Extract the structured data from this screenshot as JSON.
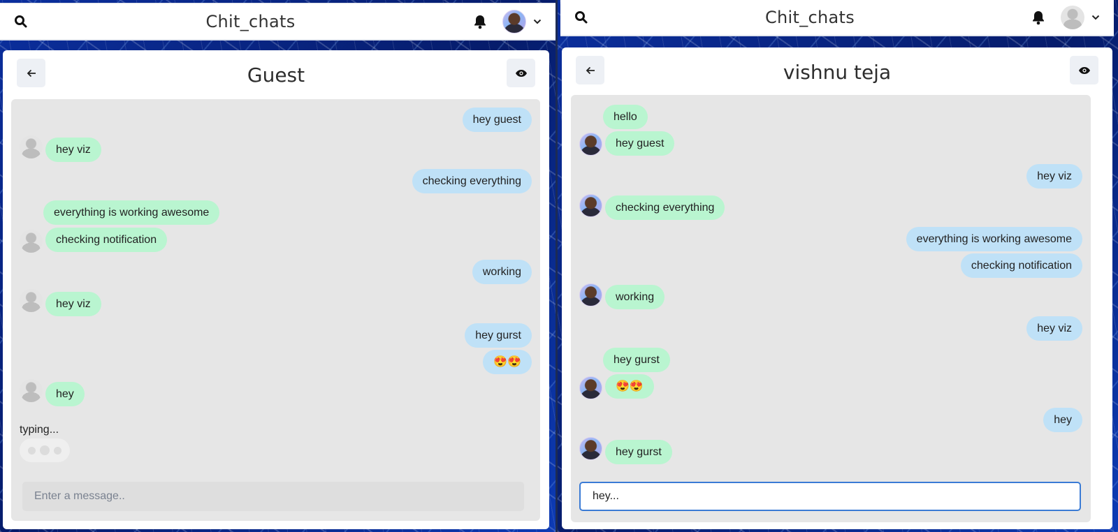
{
  "app": {
    "brand": "Chit_chats"
  },
  "left": {
    "chat_title": "Guest",
    "messages": [
      {
        "text": "hey guest",
        "side": "mine"
      },
      {
        "text": "hey viz",
        "side": "theirs"
      },
      {
        "text": "checking everything",
        "side": "mine"
      },
      {
        "text": "everything is working awesome",
        "side": "theirs"
      },
      {
        "text": "checking notification",
        "side": "theirs"
      },
      {
        "text": "working",
        "side": "mine"
      },
      {
        "text": "hey viz",
        "side": "theirs"
      },
      {
        "text": "hey gurst",
        "side": "mine"
      },
      {
        "text": "😍😍",
        "side": "mine"
      },
      {
        "text": "hey",
        "side": "theirs"
      }
    ],
    "typing_label": "typing...",
    "input": {
      "placeholder": "Enter a message..",
      "value": ""
    }
  },
  "right": {
    "chat_title": "vishnu teja",
    "messages": [
      {
        "text": "hello",
        "side": "theirs"
      },
      {
        "text": "hey guest",
        "side": "theirs"
      },
      {
        "text": "hey viz",
        "side": "mine"
      },
      {
        "text": "checking everything",
        "side": "theirs"
      },
      {
        "text": "everything is working awesome",
        "side": "mine"
      },
      {
        "text": "checking notification",
        "side": "mine"
      },
      {
        "text": "working",
        "side": "theirs"
      },
      {
        "text": "hey viz",
        "side": "mine"
      },
      {
        "text": "hey gurst",
        "side": "theirs"
      },
      {
        "text": "😍😍",
        "side": "theirs"
      },
      {
        "text": "hey",
        "side": "mine"
      },
      {
        "text": "hey gurst",
        "side": "theirs"
      }
    ],
    "input": {
      "placeholder": "",
      "value": "hey..."
    }
  },
  "colors": {
    "mine_bubble": "#bfe1f7",
    "theirs_bubble": "#b9f5d0",
    "chat_bg": "#e6e6e6",
    "focus_border": "#3a7bd5"
  },
  "icons": [
    "search-icon",
    "bell-icon",
    "chevron-down-icon",
    "arrow-left-icon",
    "eye-icon",
    "user-avatar-icon"
  ]
}
